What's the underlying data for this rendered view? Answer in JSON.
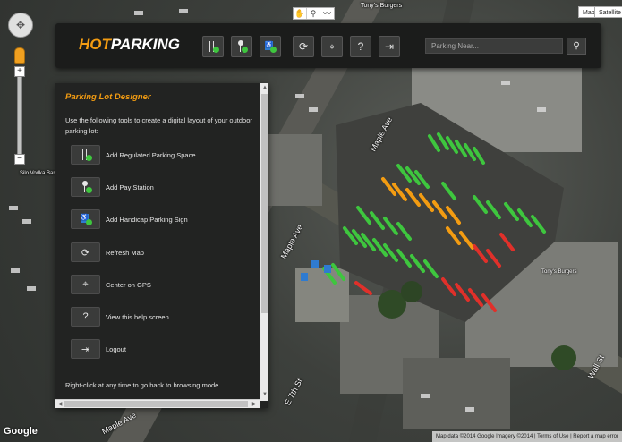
{
  "app": {
    "brand_hot": "HOT",
    "brand_parking": "PARKING"
  },
  "colors": {
    "accent": "#f39c12",
    "space_green": "#3ec63e",
    "space_orange": "#f39c12",
    "space_red": "#e0302a",
    "handicap_blue": "#2f7bd0"
  },
  "toolbar": {
    "tools": [
      {
        "name": "add-regulated-space",
        "icon": "parking-space-icon"
      },
      {
        "name": "add-pay-station",
        "icon": "pay-station-icon"
      },
      {
        "name": "add-handicap-sign",
        "icon": "handicap-sign-icon"
      },
      {
        "name": "refresh-map",
        "icon": "refresh-icon"
      },
      {
        "name": "center-gps",
        "icon": "gps-icon"
      },
      {
        "name": "help",
        "icon": "help-icon"
      },
      {
        "name": "logout",
        "icon": "logout-icon"
      }
    ],
    "search_placeholder": "Parking Near...",
    "search_icon": "search-icon"
  },
  "panel": {
    "title": "Parking Lot Designer",
    "intro": "Use the following tools to create a digital layout of your outdoor parking lot:",
    "items": [
      {
        "label": "Add Regulated Parking Space",
        "icon": "parking-space-icon"
      },
      {
        "label": "Add Pay Station",
        "icon": "pay-station-icon"
      },
      {
        "label": "Add Handicap Parking Sign",
        "icon": "handicap-sign-icon"
      },
      {
        "label": "Refresh Map",
        "icon": "refresh-icon"
      },
      {
        "label": "Center on GPS",
        "icon": "gps-icon"
      },
      {
        "label": "View this help screen",
        "icon": "help-icon"
      },
      {
        "label": "Logout",
        "icon": "logout-icon"
      }
    ],
    "footer": "Right-click at any time to go back to browsing mode."
  },
  "map": {
    "type_buttons": [
      "Map",
      "Satellite"
    ],
    "streets": {
      "maple_1": "Maple Ave",
      "maple_2": "Maple Ave",
      "maple_3": "Maple Ave",
      "e7th": "E 7th St",
      "wall": "Wall St",
      "vodka": "Silo Vodka Bar",
      "tonys": "Tony's Burgers",
      "top": "Tony's Burgers"
    },
    "logo": "Google",
    "attribution": "Map data ©2014 Google Imagery ©2014  |  Terms of Use  |  Report a map error"
  }
}
